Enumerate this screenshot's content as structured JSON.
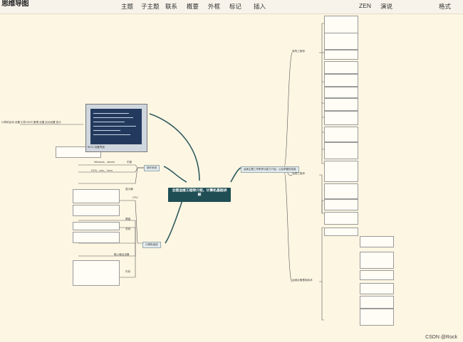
{
  "app": {
    "title": "思维导图"
  },
  "menu": {
    "topic": "主题",
    "subtopic": "子主题",
    "relation": "联系",
    "summary": "概要",
    "boundary": "外框",
    "marker": "标记",
    "insert": "插入",
    "zen": "ZEN",
    "present": "演说",
    "format": "格式"
  },
  "central": {
    "label": "全面运维工程师介绍，计算机基础讲解"
  },
  "branches": {
    "right_main": "运维主要工作职责与能力介绍，以及掌握的技能",
    "left_upper": "操作系统",
    "left_lower": "计算机组成",
    "r_arch": "架构工程师",
    "r_ops": "运维工程师",
    "r_tech": "运维必备基础技术"
  },
  "left_labels": {
    "windows": "Windows、ubuntu",
    "dos": "DOS、unix、Linux",
    "kernel": "内核",
    "display": "显示器",
    "storage": "硬盘",
    "bus": "总线",
    "io": "输入输出设备",
    "memory": "内存",
    "cpu": "CPU"
  },
  "screenshot_caption": "BIOS 设置界面",
  "image_note": "计算机启动 设置 引导 BIOS 管理 设置 启动设置 显示",
  "watermark": "CSDN @Rock"
}
